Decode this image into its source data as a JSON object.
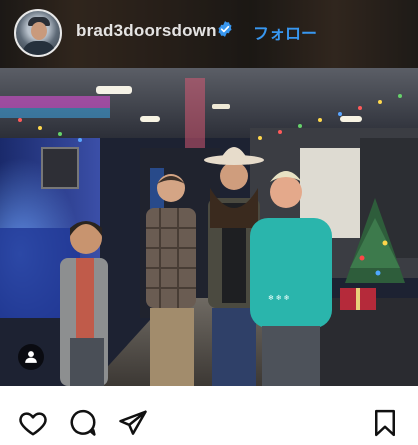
{
  "post": {
    "username": "brad3doorsdown",
    "verified": true,
    "follow_label": "フォロー",
    "avatar_icon": "profile-avatar",
    "photo_alt_icon": "group-photo"
  },
  "actions": {
    "like_icon": "heart-icon",
    "comment_icon": "comment-icon",
    "share_icon": "send-icon",
    "save_icon": "bookmark-icon"
  },
  "colors": {
    "follow_blue": "#3897f0",
    "verified_blue": "#3897f0"
  }
}
